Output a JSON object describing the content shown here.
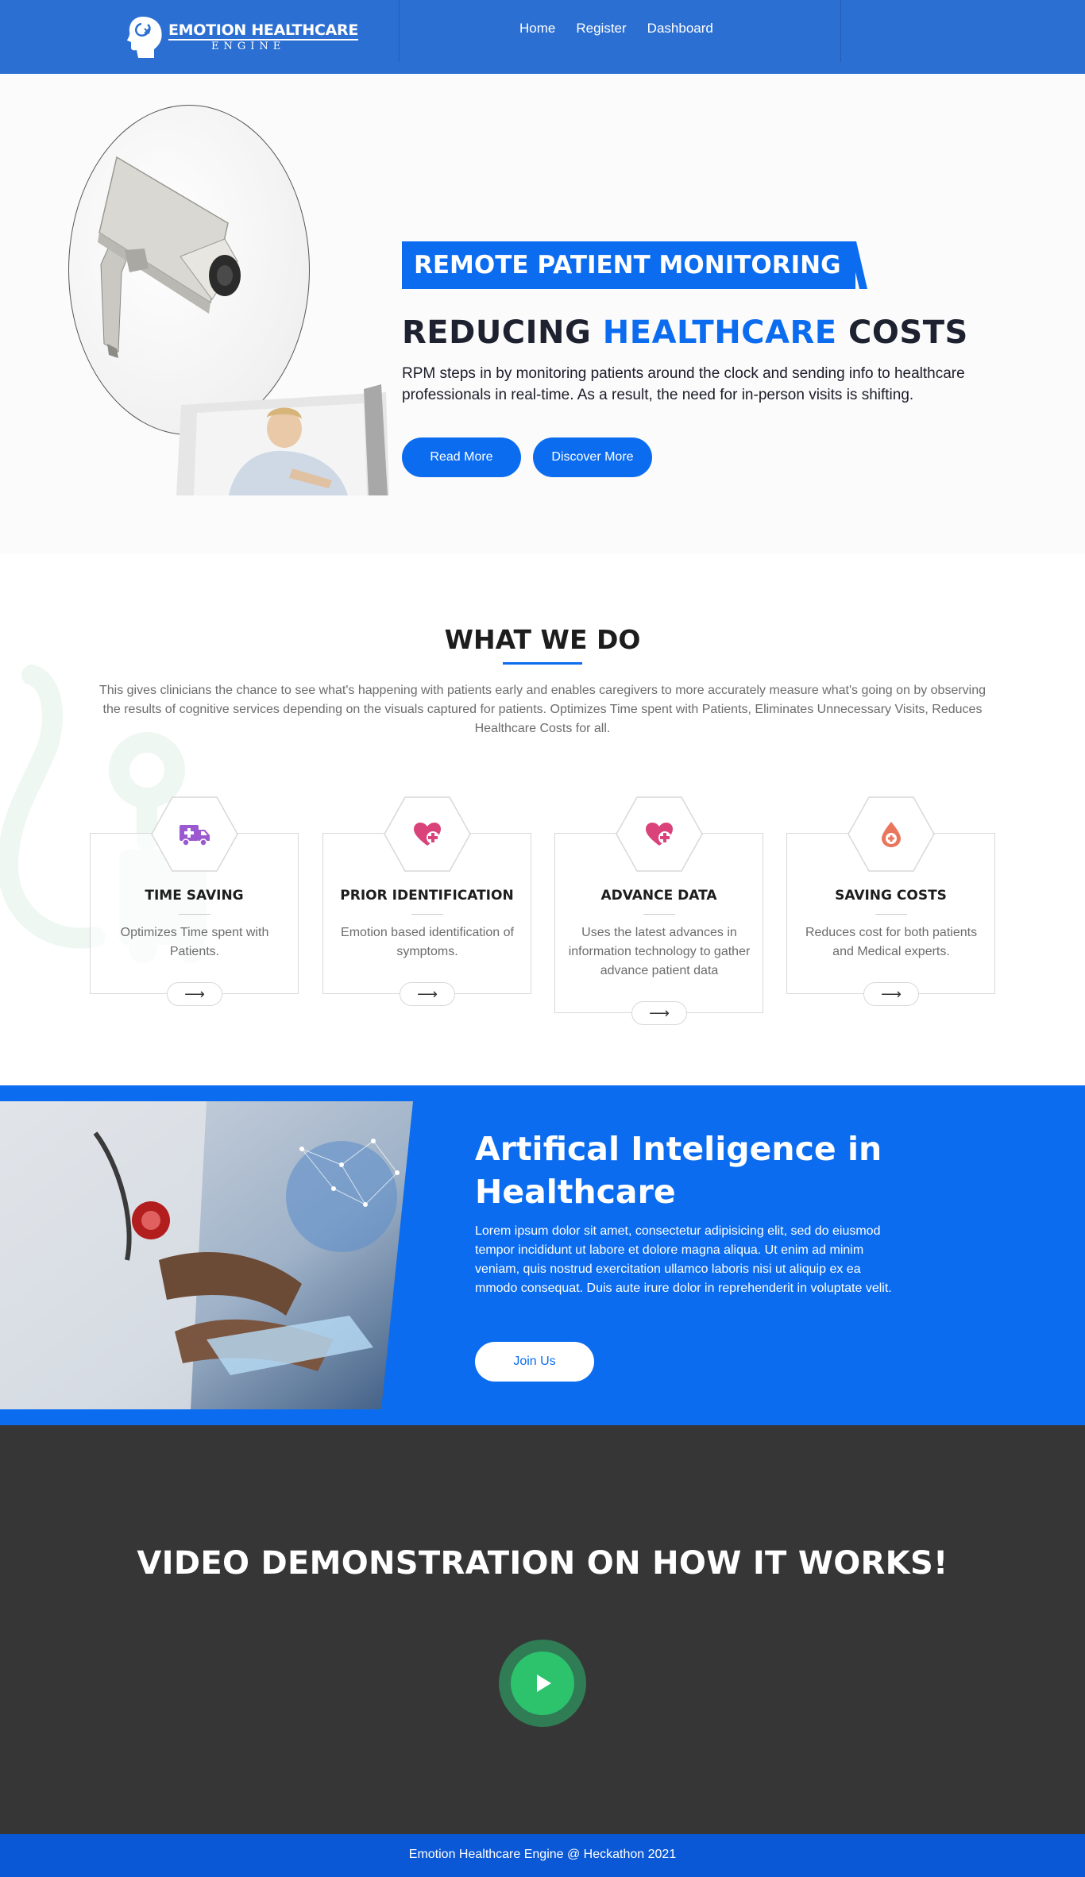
{
  "brand": {
    "title": "EMOTION HEALTHCARE",
    "subtitle": "ENGINE"
  },
  "nav": {
    "items": [
      {
        "label": "Home"
      },
      {
        "label": "Register"
      },
      {
        "label": "Dashboard"
      }
    ]
  },
  "hero": {
    "badge": "REMOTE PATIENT MONITORING",
    "title_pre": "REDUCING ",
    "title_highlight": "HEALTHCARE",
    "title_post": " COSTS",
    "text": "RPM steps in by monitoring patients around the clock and sending info to healthcare professionals in real-time. As a result, the need for in-person visits is shifting.",
    "read_more": "Read More",
    "discover_more": "Discover More"
  },
  "what_we_do": {
    "title": "WHAT WE DO",
    "text": "This gives clinicians the chance to see what's happening with patients early and enables caregivers to more accurately measure what's going on by observing the results of cognitive services depending on the visuals captured for patients. Optimizes Time spent with Patients, Eliminates Unnecessary Visits, Reduces Healthcare Costs for all.",
    "cards": [
      {
        "title": "TIME SAVING",
        "desc": "Optimizes Time spent with Patients.",
        "icon": "ambulance-icon",
        "arrow": "⟶"
      },
      {
        "title": "PRIOR IDENTIFICATION",
        "desc": "Emotion based identification of symptoms.",
        "icon": "heart-plus-icon",
        "arrow": "⟶"
      },
      {
        "title": "ADVANCE DATA",
        "desc": "Uses the latest advances in information technology to gather advance patient data",
        "icon": "heart-plus-icon",
        "arrow": "⟶"
      },
      {
        "title": "SAVING COSTS",
        "desc": "Reduces cost for both patients and Medical experts.",
        "icon": "blood-drop-icon",
        "arrow": "⟶"
      }
    ]
  },
  "ai": {
    "title": "Artifical Inteligence in Healthcare",
    "text": "Lorem ipsum dolor sit amet, consectetur adipisicing elit, sed do eiusmod tempor incididunt ut labore et dolore magna aliqua. Ut enim ad minim veniam, quis nostrud exercitation ullamco laboris nisi ut aliquip ex ea mmodo consequat. Duis aute irure dolor in reprehenderit in voluptate velit.",
    "join": "Join Us"
  },
  "video": {
    "title": "VIDEO DEMONSTRATION ON HOW IT WORKS!",
    "play_icon": "play-icon"
  },
  "footer": {
    "text": "Emotion Healthcare Engine @ Heckathon 2021"
  },
  "colors": {
    "nav_bg": "#2c6fd2",
    "accent": "#0b6cf0",
    "dark_bg": "#363636",
    "play": "#2dc36d",
    "footer_bg": "#0a58d6",
    "icon_purple": "#9b59d0",
    "icon_pink": "#d9437a",
    "icon_coral": "#e9765c"
  }
}
